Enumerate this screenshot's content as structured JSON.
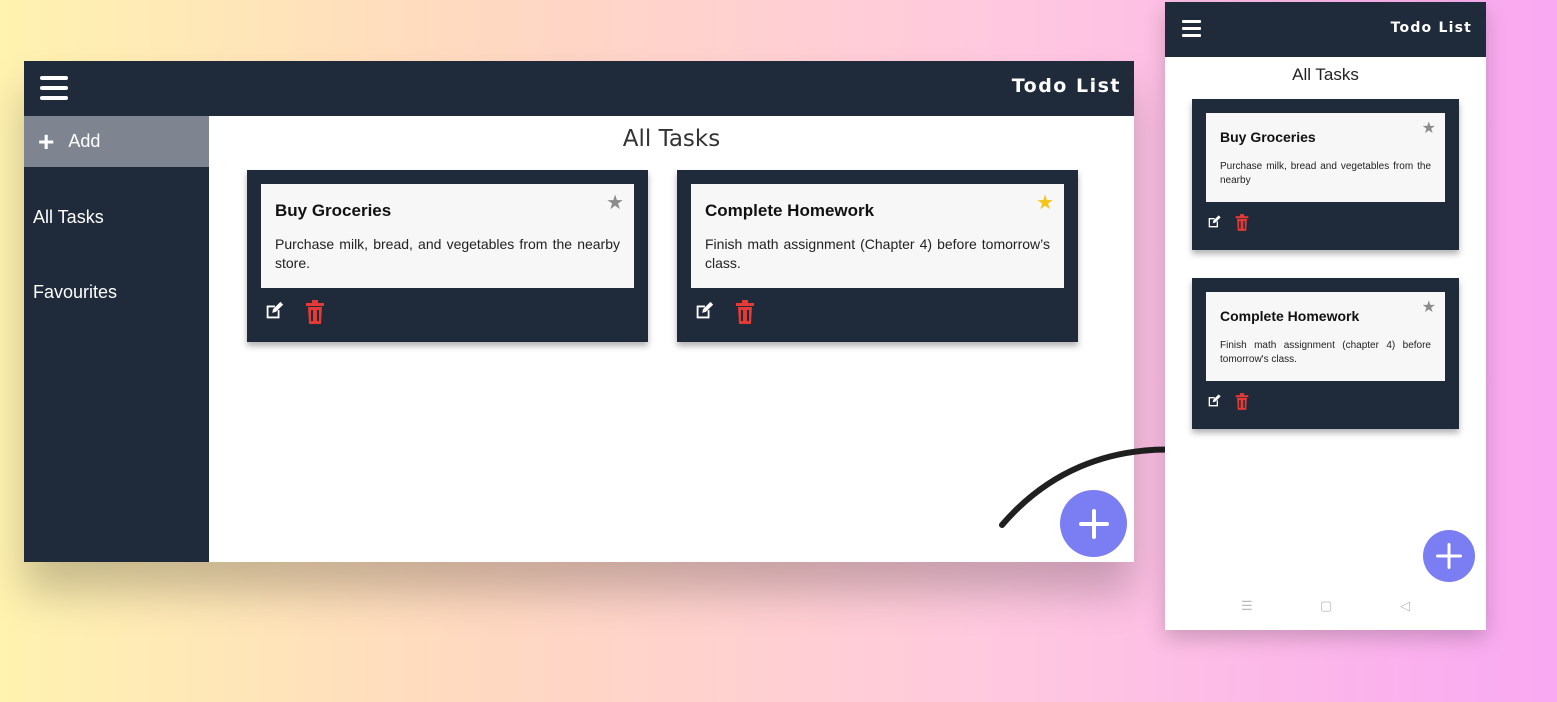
{
  "app": {
    "title": "Todo List"
  },
  "desktop": {
    "sidebar": {
      "add_label": "Add",
      "items": [
        {
          "label": "All Tasks"
        },
        {
          "label": "Favourites"
        }
      ]
    },
    "heading": "All Tasks",
    "tasks": [
      {
        "title": "Buy Groceries",
        "description": "Purchase milk, bread, and vegetables from the nearby store.",
        "favourite": false
      },
      {
        "title": "Complete Homework",
        "description": "Finish math assignment (Chapter 4) before tomorrow’s class.",
        "favourite": true
      }
    ]
  },
  "mobile": {
    "heading": "All Tasks",
    "tasks": [
      {
        "title": "Buy Groceries",
        "description": "Purchase milk, bread and vegetables from the nearby",
        "favourite": false
      },
      {
        "title": "Complete Homework",
        "description": "Finish math assignment (chapter 4) before tomorrow's class.",
        "favourite": false
      }
    ]
  },
  "icons": {
    "star": "star-icon",
    "edit": "edit-icon",
    "delete": "trash-icon",
    "menu": "hamburger-menu-icon",
    "add": "plus-icon"
  },
  "colors": {
    "navy": "#1f2a3a",
    "fab": "#7b7df3",
    "delete": "#e53935",
    "star_active": "#f5c518",
    "star_inactive": "#8c8c8c"
  }
}
